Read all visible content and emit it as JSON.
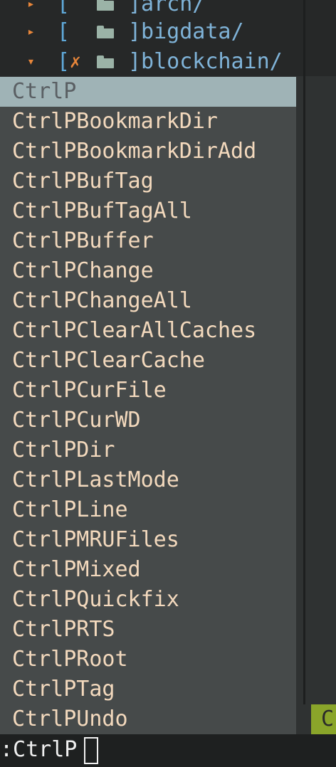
{
  "file_tree": {
    "rows": [
      {
        "arrow": "▸",
        "bracket": "[",
        "flag": "",
        "name": "]arch/"
      },
      {
        "arrow": "▸",
        "bracket": "[",
        "flag": "",
        "name": "]bigdata/"
      },
      {
        "arrow": "▾",
        "bracket": "[",
        "flag": "✗",
        "name": "]blockchain/"
      }
    ]
  },
  "popup_menu": {
    "items": [
      "CtrlP",
      "CtrlPBookmarkDir",
      "CtrlPBookmarkDirAdd",
      "CtrlPBufTag",
      "CtrlPBufTagAll",
      "CtrlPBuffer",
      "CtrlPChange",
      "CtrlPChangeAll",
      "CtrlPClearAllCaches",
      "CtrlPClearCache",
      "CtrlPCurFile",
      "CtrlPCurWD",
      "CtrlPDir",
      "CtrlPLastMode",
      "CtrlPLine",
      "CtrlPMRUFiles",
      "CtrlPMixed",
      "CtrlPQuickfix",
      "CtrlPRTS",
      "CtrlPRoot",
      "CtrlPTag",
      "CtrlPUndo"
    ],
    "selected_index": 0
  },
  "statusline": {
    "chip_text": "C"
  },
  "cmdline": {
    "text": ":CtrlP"
  },
  "icons": {
    "folder": "folder-icon",
    "collapsed": "triangle-right-icon",
    "expanded": "triangle-down-icon",
    "modified": "x-mark-icon"
  }
}
